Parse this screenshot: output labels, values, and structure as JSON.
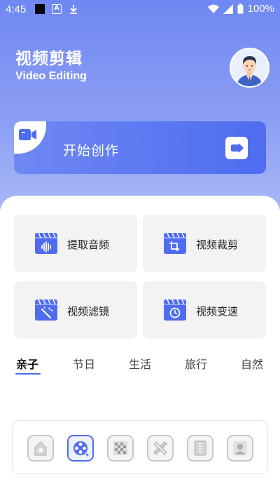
{
  "status_bar": {
    "time": "4:45",
    "battery": "100%"
  },
  "header": {
    "title": "视频剪辑",
    "subtitle": "Video Editing"
  },
  "start_card": {
    "label": "开始创作"
  },
  "tools": [
    {
      "label": "提取音频"
    },
    {
      "label": "视频裁剪"
    },
    {
      "label": "视频滤镜"
    },
    {
      "label": "视频变速"
    }
  ],
  "tabs": [
    "亲子",
    "节日",
    "生活",
    "旅行",
    "自然"
  ],
  "active_tab": "亲子",
  "colors": {
    "accent": "#4f6cf0",
    "hero_top": "#6f87f2"
  },
  "bottom_nav": {
    "items": [
      "home-icon",
      "film-reel-icon",
      "mosaic-icon",
      "pencil-ruler-icon",
      "notebook-icon",
      "person-icon"
    ],
    "active": "film-reel-icon"
  }
}
